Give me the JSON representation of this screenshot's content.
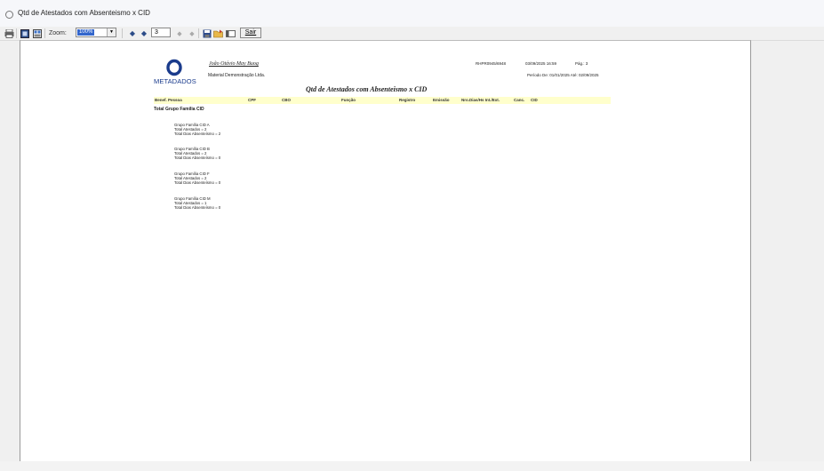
{
  "window": {
    "title": "Qtd de Atestados com Absenteismo x CID"
  },
  "toolbar": {
    "zoom_label": "Zoom:",
    "zoom_value": "100%",
    "page_number": "3",
    "exit_label": "Sair"
  },
  "report": {
    "person_name": "João Otávio May Buog",
    "company": "Material Demonstração Ltda.",
    "report_id": "RHPR0945/6948",
    "datetime": "03/09/2025 16:59",
    "page_label": "Pág.: 3",
    "period": "Período De: 01/01/2025 Até: 02/09/2025",
    "title": "Qtd de Atestados com Absenteismo x CID",
    "logo_text": "METADADOS",
    "columns": [
      "Benef. Pessoa",
      "CPF",
      "CBO",
      "Função",
      "Registro",
      "Emissão",
      "Nro.Dias/Hs Int./Ext.",
      "Canc.",
      "CID"
    ],
    "group_title": "Total Grupo Família CID",
    "groups": [
      {
        "name": "Grupo Família CID  A",
        "total_atestados": "Total Atestados = 2",
        "total_dias": "Total Dias Absenteísmo = 2"
      },
      {
        "name": "Grupo Família CID  B",
        "total_atestados": "Total Atestados = 2",
        "total_dias": "Total Dias Absenteísmo = 0"
      },
      {
        "name": "Grupo Família CID  F",
        "total_atestados": "Total Atestados = 2",
        "total_dias": "Total Dias Absenteísmo = 0"
      },
      {
        "name": "Grupo Família CID  M",
        "total_atestados": "Total Atestados = 1",
        "total_dias": "Total Dias Absenteísmo = 0"
      }
    ]
  },
  "colors": {
    "header_band": "#ffffcc",
    "logo_blue": "#1a3b8c",
    "zoom_highlight": "#3366cc"
  }
}
